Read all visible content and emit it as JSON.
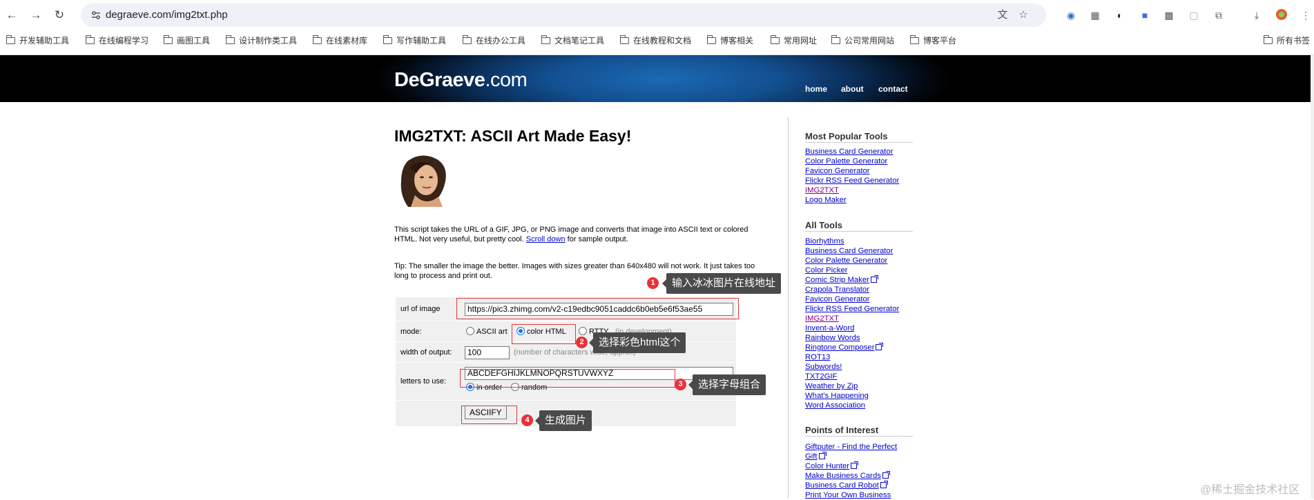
{
  "browser": {
    "url": "degraeve.com/img2txt.php",
    "bookmarks": [
      "开发辅助工具",
      "在线编程学习",
      "画图工具",
      "设计制作类工具",
      "在线素材库",
      "写作辅助工具",
      "在线办公工具",
      "文档笔记工具",
      "在线教程和文档",
      "博客相关",
      "常用网址",
      "公司常用网站",
      "博客平台"
    ],
    "all_bookmarks": "所有书签"
  },
  "site": {
    "logo_main": "DeGraeve",
    "logo_dom": ".com",
    "nav": [
      "home",
      "about",
      "contact"
    ]
  },
  "main": {
    "title": "IMG2TXT: ASCII Art Made Easy!",
    "intro_1": "This script takes the URL of a GIF, JPG, or PNG image and converts that image into ASCII text or colored HTML. Not very useful, but pretty cool.",
    "intro_link": "Scroll down",
    "intro_2": "for sample output.",
    "tip": "Tip: The smaller the image the better. Images with sizes greater than 640x480 will not work. It just takes too long to process and print out."
  },
  "form": {
    "url_label": "url of image",
    "url_value": "https://pic3.zhimg.com/v2-c19edbc9051caddc6b0eb5e6f53ae55",
    "mode_label": "mode:",
    "mode_options": [
      "ASCII art",
      "color HTML",
      "RTTY",
      "(in development)"
    ],
    "width_label": "width of output:",
    "width_value": "100",
    "width_hint": "(number of characters wide, approx)",
    "letters_label": "letters to use:",
    "letters_value": "ABCDEFGHIJKLMNOPQRSTUVWXYZ",
    "order_options": [
      "in order",
      "random"
    ],
    "submit": "ASCIIFY"
  },
  "annotations": [
    {
      "num": "1",
      "text": "输入冰冰图片在线地址"
    },
    {
      "num": "2",
      "text": "选择彩色html这个"
    },
    {
      "num": "3",
      "text": "选择字母组合"
    },
    {
      "num": "4",
      "text": "生成图片"
    }
  ],
  "sidebar": {
    "popular_title": "Most Popular Tools",
    "popular": [
      "Business Card Generator",
      "Color Palette Generator",
      "Favicon Generator",
      "Flickr RSS Feed Generator",
      "IMG2TXT",
      "Logo Maker"
    ],
    "all_title": "All Tools",
    "all": [
      "Biorhythms",
      "Business Card Generator",
      "Color Palette Generator",
      "Color Picker",
      "Comic Strip Maker",
      "Crapola Translator",
      "Favicon Generator",
      "Flickr RSS Feed Generator",
      "IMG2TXT",
      "Invent-a-Word",
      "Rainbow Words",
      "Ringtone Composer",
      "ROT13",
      "Subwords!",
      "TXT2GIF",
      "Weather by Zip",
      "What's Happening",
      "Word Association"
    ],
    "poi_title": "Points of Interest",
    "poi": [
      "Giftputer - Find the Perfect",
      "Gift",
      "Color Hunter",
      "Make Business Cards",
      "Business Card Robot",
      "Print Your Own Business"
    ]
  },
  "watermark": "@稀土掘金技术社区"
}
